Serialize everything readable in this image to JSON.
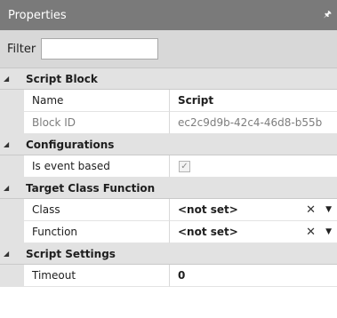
{
  "panel": {
    "title": "Properties"
  },
  "filter": {
    "label": "Filter",
    "value": ""
  },
  "categories": {
    "script_block": {
      "name": "Script Block",
      "name_label": "Name",
      "name_value": "Script",
      "block_id_label": "Block ID",
      "block_id_value": "ec2c9d9b-42c4-46d8-b55b"
    },
    "configurations": {
      "name": "Configurations",
      "event_based_label": "Is event based",
      "event_based_checked": true
    },
    "target_class_function": {
      "name": "Target Class Function",
      "class_label": "Class",
      "class_value": "<not set>",
      "function_label": "Function",
      "function_value": "<not set>"
    },
    "script_settings": {
      "name": "Script Settings",
      "timeout_label": "Timeout",
      "timeout_value": "0"
    }
  },
  "icons": {
    "pin": "pin-icon",
    "collapse": "collapse-triangle-icon",
    "clear": "clear-x-icon",
    "dropdown": "dropdown-arrow-icon",
    "check": "checkmark-icon"
  }
}
